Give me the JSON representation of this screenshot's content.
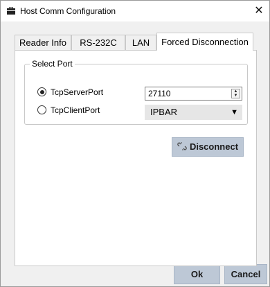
{
  "window": {
    "title": "Host Comm Configuration",
    "close_glyph": "✕"
  },
  "tabs": [
    {
      "label": "Reader Info",
      "active": false
    },
    {
      "label": "RS-232C",
      "active": false
    },
    {
      "label": "LAN",
      "active": false
    },
    {
      "label": "Forced Disconnection",
      "active": true
    }
  ],
  "group": {
    "label": "Select Port",
    "options": [
      {
        "label": "TcpServerPort",
        "selected": true
      },
      {
        "label": "TcpClientPort",
        "selected": false
      }
    ],
    "server_port_value": "27110",
    "client_port_select": "IPBAR"
  },
  "actions": {
    "disconnect_label": "Disconnect",
    "ok_label": "Ok",
    "cancel_label": "Cancel"
  },
  "colors": {
    "button_bg": "#bdc8d6",
    "panel_bg": "#ffffff",
    "window_bg": "#f0f0f0"
  }
}
